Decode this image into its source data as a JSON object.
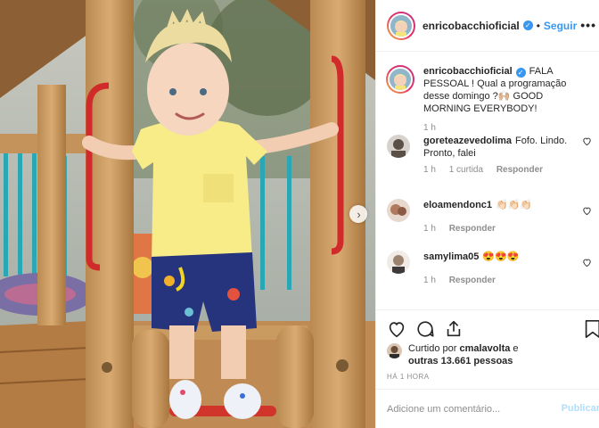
{
  "post": {
    "username": "enricobacchioficial",
    "follow_label": "Seguir",
    "more_label": "•••",
    "verified_glyph": "✓"
  },
  "caption": {
    "username": "enricobacchioficial",
    "text": "FALA PESSOAL ! Qual a programação desse domingo ?🙌🏼 GOOD MORNING EVERYBODY!",
    "time": "1 h"
  },
  "comments": [
    {
      "username": "goreteazevedolima",
      "text": "Fofo. Lindo. Pronto, falei",
      "time": "1 h",
      "likes": "1 curtida",
      "reply": "Responder",
      "avatar_color": "#5a5048"
    },
    {
      "username": "eloamendonc1",
      "text": "👏🏻👏🏻👏🏻",
      "time": "1 h",
      "likes": "",
      "reply": "Responder",
      "avatar_color": "#b07a5e"
    },
    {
      "username": "samylima05",
      "text": "😍😍😍",
      "time": "1 h",
      "likes": "",
      "reply": "Responder",
      "avatar_color": "#9c8370"
    }
  ],
  "likes": {
    "prefix": "Curtido por",
    "user": "cmalavolta",
    "connector": "e",
    "others": "outras 13.661 pessoas"
  },
  "timestamp": "HÁ 1 HORA",
  "add_comment": {
    "placeholder": "Adicione um comentário...",
    "publish_label": "Publicar"
  },
  "icons": [
    "heart-icon",
    "comment-icon",
    "share-icon",
    "bookmark-icon",
    "chevron-right-icon",
    "verified-icon"
  ],
  "colors": {
    "link_blue": "#3897f0",
    "publish_disabled": "#b2dffc",
    "muted": "#8e8e8e"
  }
}
